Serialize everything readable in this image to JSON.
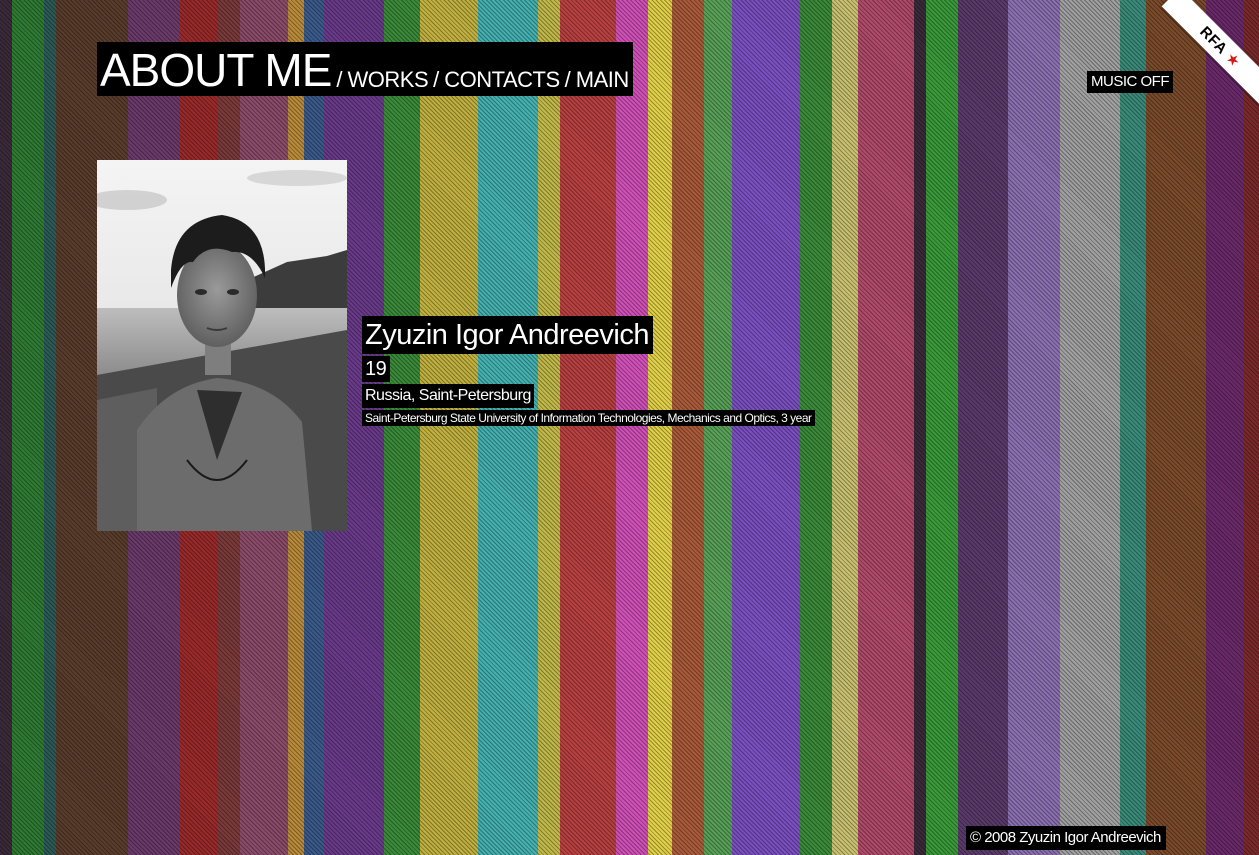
{
  "nav": {
    "current": "ABOUT ME",
    "items": [
      "WORKS",
      "CONTACTS",
      "MAIN"
    ],
    "separator": "/"
  },
  "music_toggle": "MUSIC OFF",
  "ribbon": {
    "text": "RFA",
    "star": "★"
  },
  "profile": {
    "name": "Zyuzin Igor Andreevich",
    "age": "19",
    "location": "Russia, Saint-Petersburg",
    "university": "Saint-Petersburg State University of Information Technologies, Mechanics and Optics, 3 year"
  },
  "photo_icon": "portrait-photo",
  "footer": {
    "copyright": "© 2008 Zyuzin Igor Andreevich"
  },
  "colors": {
    "label_bg": "#000000",
    "label_text": "#ffffff",
    "ribbon_bg": "#ffffff",
    "ribbon_star": "#d41a1a",
    "stripes": [
      "#3b2a3a",
      "#2f7a33",
      "#2c5a56",
      "#5a3c2c",
      "#6a3a6a",
      "#9a2a2a",
      "#7a3a3a",
      "#8a4a6a",
      "#b98a3a",
      "#3a5a8a",
      "#6a3a8a",
      "#3a8a3a",
      "#c0b040",
      "#44b0b0",
      "#c0b848",
      "#b84040",
      "#d050b8",
      "#e0d048",
      "#a85a3a",
      "#58a058",
      "#7a50c0",
      "#3a8a3a",
      "#c8c070",
      "#b04a6a",
      "#3a2a3a",
      "#3a9a3a",
      "#5a3a6a",
      "#8a70b0",
      "#a0a0a0",
      "#3a8a7a",
      "#7a4a2a",
      "#6a2a6a",
      "#7a2a2a",
      "#2a5a5a"
    ]
  }
}
